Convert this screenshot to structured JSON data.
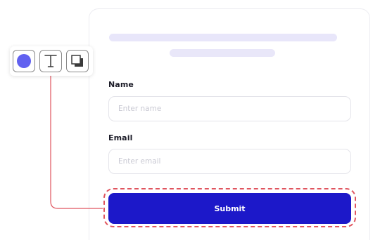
{
  "form": {
    "name_label": "Name",
    "name_placeholder": "Enter name",
    "email_label": "Email",
    "email_placeholder": "Enter email",
    "submit_label": "Submit"
  },
  "toolbar": {
    "tools": [
      {
        "name": "color-tool",
        "icon": "color-circle-icon"
      },
      {
        "name": "text-tool",
        "icon": "text-t-icon"
      },
      {
        "name": "shadow-tool",
        "icon": "drop-shadow-icon"
      }
    ]
  },
  "colors": {
    "primary_button": "#1c18c9",
    "selection_dashes": "#e0555f",
    "connector_line": "#e0555f",
    "color_swatch": "#6161f0",
    "skeleton": "#e8e6fa"
  }
}
